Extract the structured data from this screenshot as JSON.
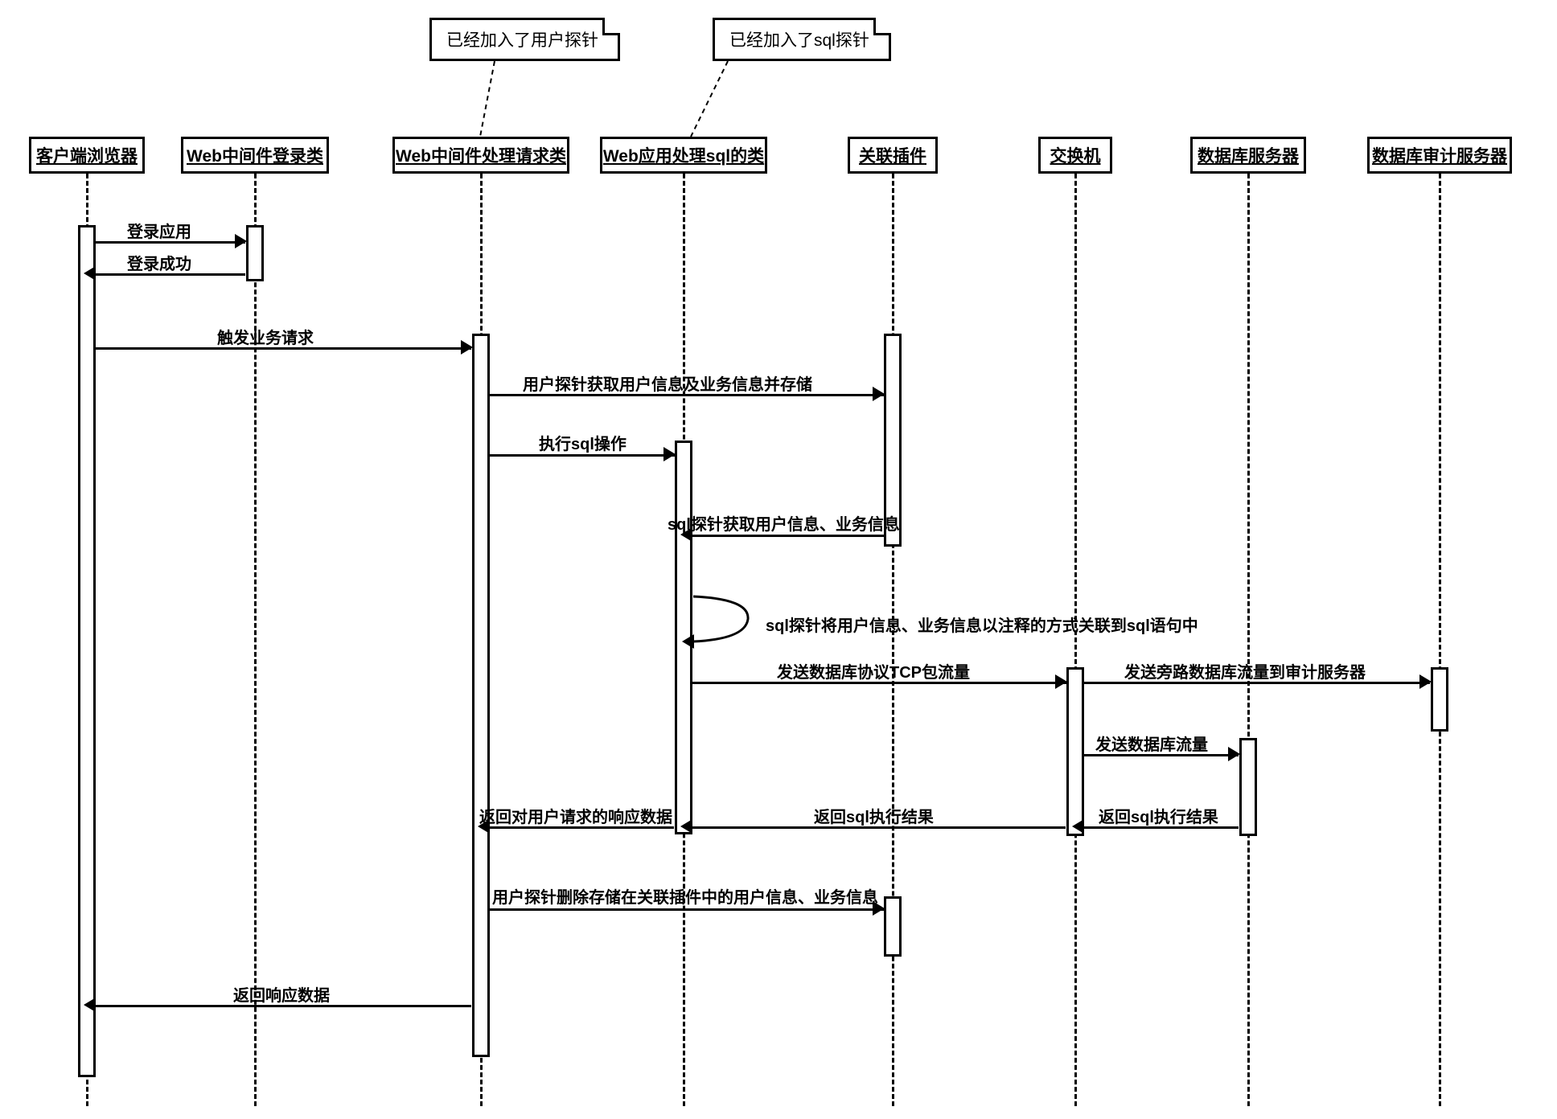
{
  "diagram": {
    "type": "uml-sequence",
    "notes": {
      "userProbe": "已经加入了用户探针",
      "sqlProbe": "已经加入了sql探针"
    },
    "lifelines": {
      "client": "客户端浏览器",
      "loginClass": "Web中间件登录类",
      "requestClass": "Web中间件处理请求类",
      "sqlClass": "Web应用处理sql的类",
      "assocPlugin": "关联插件",
      "switch": "交换机",
      "dbServer": "数据库服务器",
      "auditServer": "数据库审计服务器"
    },
    "messages": {
      "loginApp": "登录应用",
      "loginSuccess": "登录成功",
      "triggerReq": "触发业务请求",
      "userProbeStore": "用户探针获取用户信息及业务信息并存储",
      "execSql": "执行sql操作",
      "sqlProbeGet": "sql探针获取用户信息、业务信息",
      "selfAssoc": "sql探针将用户信息、业务信息以注释的方式关联到sql语句中",
      "sendTcp": "发送数据库协议TCP包流量",
      "sendBypass": "发送旁路数据库流量到审计服务器",
      "sendDbTraffic": "发送数据库流量",
      "returnSqlResult1": "返回sql执行结果",
      "returnSqlResult2": "返回sql执行结果",
      "returnRespData": "返回对用户请求的响应数据",
      "userProbeDelete": "用户探针删除存储在关联插件中的用户信息、业务信息",
      "returnResponse": "返回响应数据"
    }
  }
}
